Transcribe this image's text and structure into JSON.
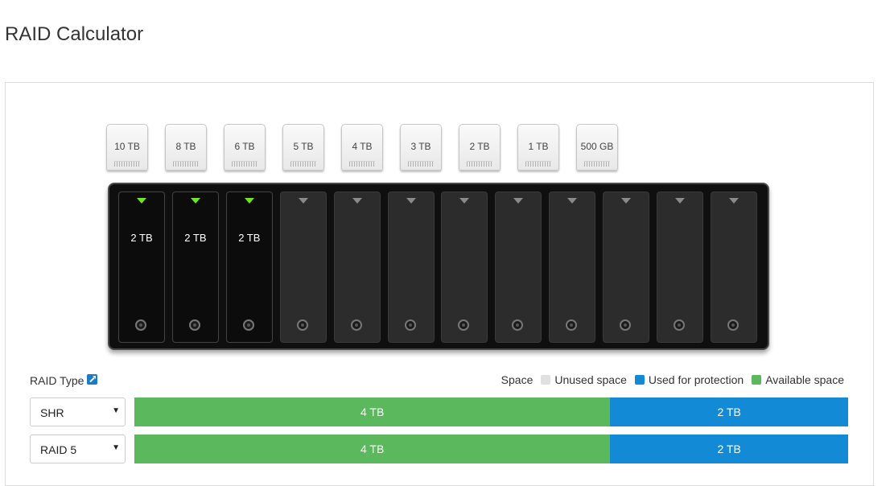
{
  "page_title": "RAID Calculator",
  "disk_options": [
    "10 TB",
    "8 TB",
    "6 TB",
    "5 TB",
    "4 TB",
    "3 TB",
    "2 TB",
    "1 TB",
    "500 GB"
  ],
  "bays": [
    {
      "label": "2 TB",
      "filled": true
    },
    {
      "label": "2 TB",
      "filled": true
    },
    {
      "label": "2 TB",
      "filled": true
    },
    {
      "label": "",
      "filled": false
    },
    {
      "label": "",
      "filled": false
    },
    {
      "label": "",
      "filled": false
    },
    {
      "label": "",
      "filled": false
    },
    {
      "label": "",
      "filled": false
    },
    {
      "label": "",
      "filled": false
    },
    {
      "label": "",
      "filled": false
    },
    {
      "label": "",
      "filled": false
    },
    {
      "label": "",
      "filled": false
    }
  ],
  "raid_type_label": "RAID Type",
  "legend": {
    "title": "Space",
    "items": [
      {
        "label": "Unused space",
        "color": "#e0e0e0"
      },
      {
        "label": "Used for protection",
        "color": "#128ad6"
      },
      {
        "label": "Available space",
        "color": "#5cb85c"
      }
    ]
  },
  "raid_rows": [
    {
      "type": "SHR",
      "available": {
        "label": "4 TB",
        "tb": 4
      },
      "protection": {
        "label": "2 TB",
        "tb": 2
      }
    },
    {
      "type": "RAID 5",
      "available": {
        "label": "4 TB",
        "tb": 4
      },
      "protection": {
        "label": "2 TB",
        "tb": 2
      }
    }
  ],
  "colors": {
    "available": "#5cb85c",
    "protection": "#128ad6",
    "unused": "#e0e0e0"
  }
}
